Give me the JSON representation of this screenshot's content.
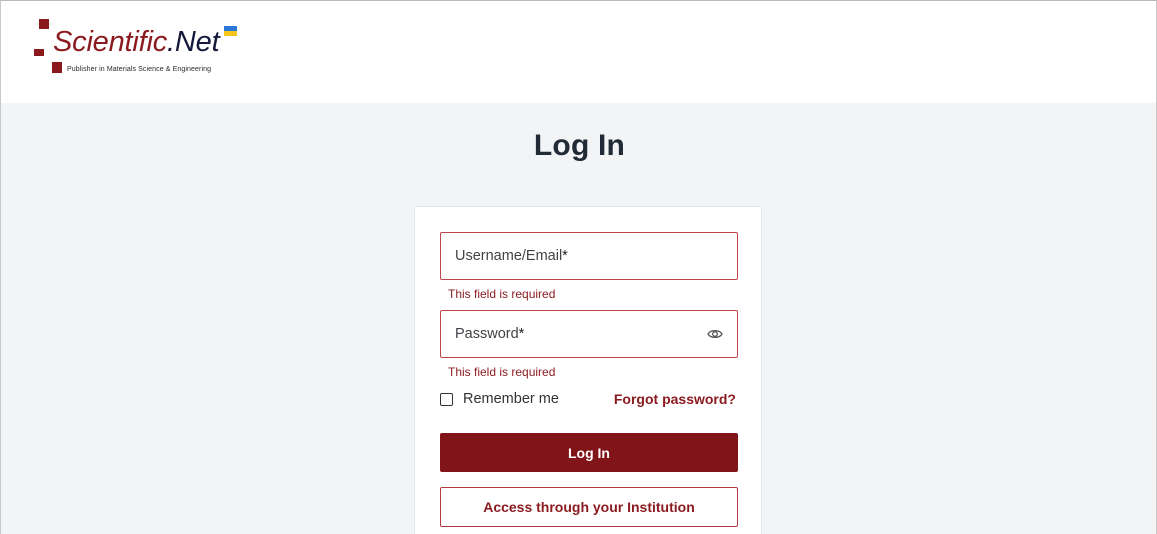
{
  "header": {
    "logo": {
      "name_part1": "Scientific",
      "name_part2": ".Net",
      "tagline": "Publisher in Materials Science & Engineering",
      "flag_icon": "ukraine-flag-icon"
    }
  },
  "page": {
    "title": "Log In"
  },
  "form": {
    "username": {
      "placeholder": "Username/Email",
      "required_mark": "*",
      "value": "",
      "error": "This field is required"
    },
    "password": {
      "placeholder": "Password",
      "required_mark": "*",
      "value": "",
      "error": "This field is required",
      "toggle_icon": "eye-icon"
    },
    "remember_me": {
      "label": "Remember me",
      "checked": false
    },
    "forgot_password": "Forgot password?",
    "login_button": "Log In",
    "institution_button": "Access through your Institution"
  },
  "colors": {
    "brand": "#8b1a1f",
    "button": "#811418",
    "error_border": "#c2454c",
    "background": "#f2f4f6"
  }
}
